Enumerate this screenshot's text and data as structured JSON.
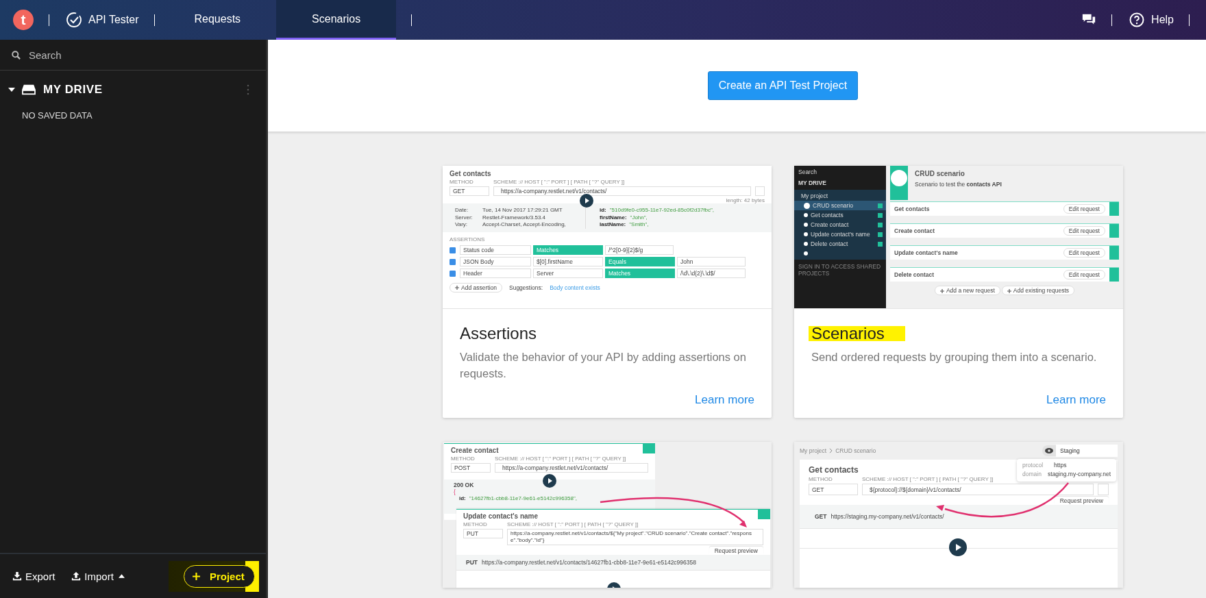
{
  "topbar": {
    "logo": "t",
    "app_name": "API Tester",
    "tabs": [
      {
        "label": "Requests",
        "selected": false
      },
      {
        "label": "Scenarios",
        "selected": true
      }
    ],
    "help": "Help"
  },
  "sidebar": {
    "search": {
      "placeholder": "Search"
    },
    "drive": {
      "label": "MY DRIVE",
      "expanded": true
    },
    "empty": "NO SAVED DATA",
    "export": "Export",
    "import": "Import",
    "project_button": "Project"
  },
  "main": {
    "create_button": "Create an API Test Project",
    "cards": [
      {
        "kind": "assertions",
        "title": "Assertions",
        "description": "Validate the behavior of your API by adding assertions on requests.",
        "link": "Learn more",
        "preview": {
          "title": "Get contacts",
          "method_label": "METHOD",
          "url_label": "SCHEME :// HOST [ \":\" PORT ] [ PATH [ \"?\" QUERY ]]",
          "method": "GET",
          "url": "https://a-company.restlet.net/v1/contacts/",
          "length": "length: 42 bytes",
          "headers": [
            {
              "name": "Date:",
              "value": "Tue, 14 Nov 2017 17:29:21 GMT"
            },
            {
              "name": "Server:",
              "value": "Restlet-Framework/3.53.4"
            },
            {
              "name": "Vary:",
              "value": "Accept-Charset, Accept-Encoding,"
            }
          ],
          "body": [
            {
              "key": "id:",
              "value": "\"510d9fe0-c955-11e7-92ed-85c0f2d37fbc\","
            },
            {
              "key": "firstName:",
              "value": "\"John\","
            },
            {
              "key": "lastName:",
              "value": "\"Smith\","
            }
          ],
          "assertions_label": "ASSERTIONS",
          "assertions": [
            {
              "checked": true,
              "source": "Status code",
              "comparison": "Matches",
              "value": "/^2[0-9]{2}$/g"
            },
            {
              "checked": true,
              "source": "JSON Body",
              "path": "$[0].firstName",
              "comparison": "Equals",
              "value": "John"
            },
            {
              "checked": true,
              "source": "Header",
              "path": "Server",
              "comparison": "Matches",
              "value": "/\\d\\.\\d{2}\\.\\d$/"
            }
          ],
          "add_assertion": "Add assertion",
          "suggestions_label": "Suggestions:",
          "suggestion": "Body content exists"
        }
      },
      {
        "kind": "scenarios",
        "title": "Scenarios",
        "description": "Send ordered requests by grouping them into a scenario.",
        "link": "Learn more",
        "preview": {
          "search": "Search",
          "drive": "MY DRIVE",
          "project": "My project",
          "scenario": {
            "name": "CRUD scenario",
            "checked": true
          },
          "requests": [
            {
              "name": "Get contacts",
              "checked": true
            },
            {
              "name": "Create contact",
              "checked": true
            },
            {
              "name": "Update contact's name",
              "checked": true
            },
            {
              "name": "Delete contact",
              "checked": true
            }
          ],
          "sign_in": "SIGN IN TO ACCESS SHARED PROJECTS",
          "title": "CRUD scenario",
          "description": "Scenario to test the **contacts API**",
          "steps": [
            {
              "name": "Get contacts",
              "edit_button": "Edit request"
            },
            {
              "name": "Create contact",
              "edit_button": "Edit request"
            },
            {
              "name": "Update contact's name",
              "edit_button": "Edit request"
            },
            {
              "name": "Delete contact",
              "edit_button": "Edit request"
            }
          ],
          "add_new": "Add a new request",
          "add_existing": "Add existing requests"
        }
      },
      {
        "kind": "chaining",
        "preview": {
          "first": {
            "title": "Create contact",
            "method_label": "METHOD",
            "url_label": "SCHEME :// HOST [ \":\" PORT ] [ PATH [ \"?\" QUERY ]]",
            "method": "POST",
            "url": "https://a-company.restlet.net/v1/contacts/",
            "status": "200 OK",
            "brace": "{",
            "id_key": "id:",
            "id_value": "\"14627fb1-cbb8-11e7-9e61-e5142c996358\","
          },
          "second": {
            "title": "Update contact's name",
            "method_label": "METHOD",
            "url_label": "SCHEME :// HOST [ \":\" PORT ] [ PATH [ \"?\" QUERY ]]",
            "method": "PUT",
            "url": "https://a-company.restlet.net/v1/contacts/${\"My project\".\"CRUD scenario\".\"Create contact\".\"response\".\"body\".\"id\"}",
            "preview_toggle": "Request preview",
            "preview_method": "PUT",
            "preview_url": "https://a-company.restlet.net/v1/contacts/14627fb1-cbb8-11e7-9e61-e5142c996358"
          }
        }
      },
      {
        "kind": "environments",
        "preview": {
          "breadcrumb": [
            "My project",
            "CRUD scenario"
          ],
          "environment": "Staging",
          "variables": [
            {
              "name": "protocol",
              "value": "https"
            },
            {
              "name": "domain",
              "value": "staging.my-company.net"
            }
          ],
          "title": "Get contacts",
          "method_label": "METHOD",
          "url_label": "SCHEME :// HOST [ \":\" PORT ] [ PATH [ \"?\" QUERY ]]",
          "method": "GET",
          "url": "${protocol}://${domain}/v1/contacts/",
          "preview_toggle": "Request preview",
          "preview_method": "GET",
          "preview_url": "https://staging.my-company.net/v1/contacts/"
        }
      }
    ]
  }
}
